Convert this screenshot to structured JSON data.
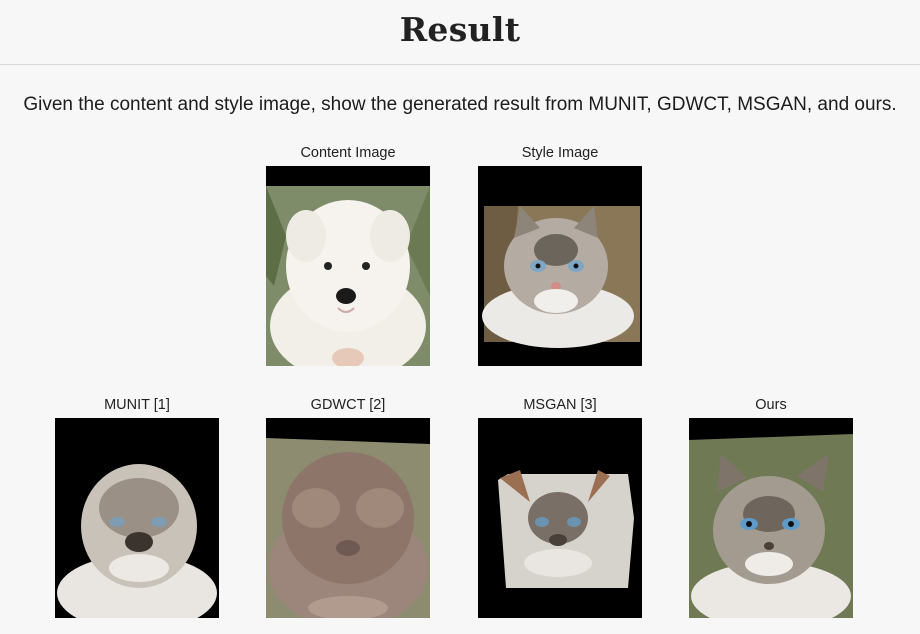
{
  "header": {
    "title": "Result"
  },
  "description": "Given the content and style image, show the generated result from MUNIT, GDWCT, MSGAN, and ours.",
  "figures": {
    "content": {
      "caption": "Content Image"
    },
    "style": {
      "caption": "Style Image"
    },
    "munit": {
      "caption": "MUNIT [1]"
    },
    "gdwct": {
      "caption": "GDWCT [2]"
    },
    "msgan": {
      "caption": "MSGAN [3]"
    },
    "ours": {
      "caption": "Ours"
    }
  },
  "images": {
    "content": "white-puppy-photo",
    "style": "tabby-cat-photo",
    "munit": "generated-cat-munit",
    "gdwct": "generated-cat-gdwct",
    "msgan": "generated-cat-msgan",
    "ours": "generated-cat-ours"
  }
}
